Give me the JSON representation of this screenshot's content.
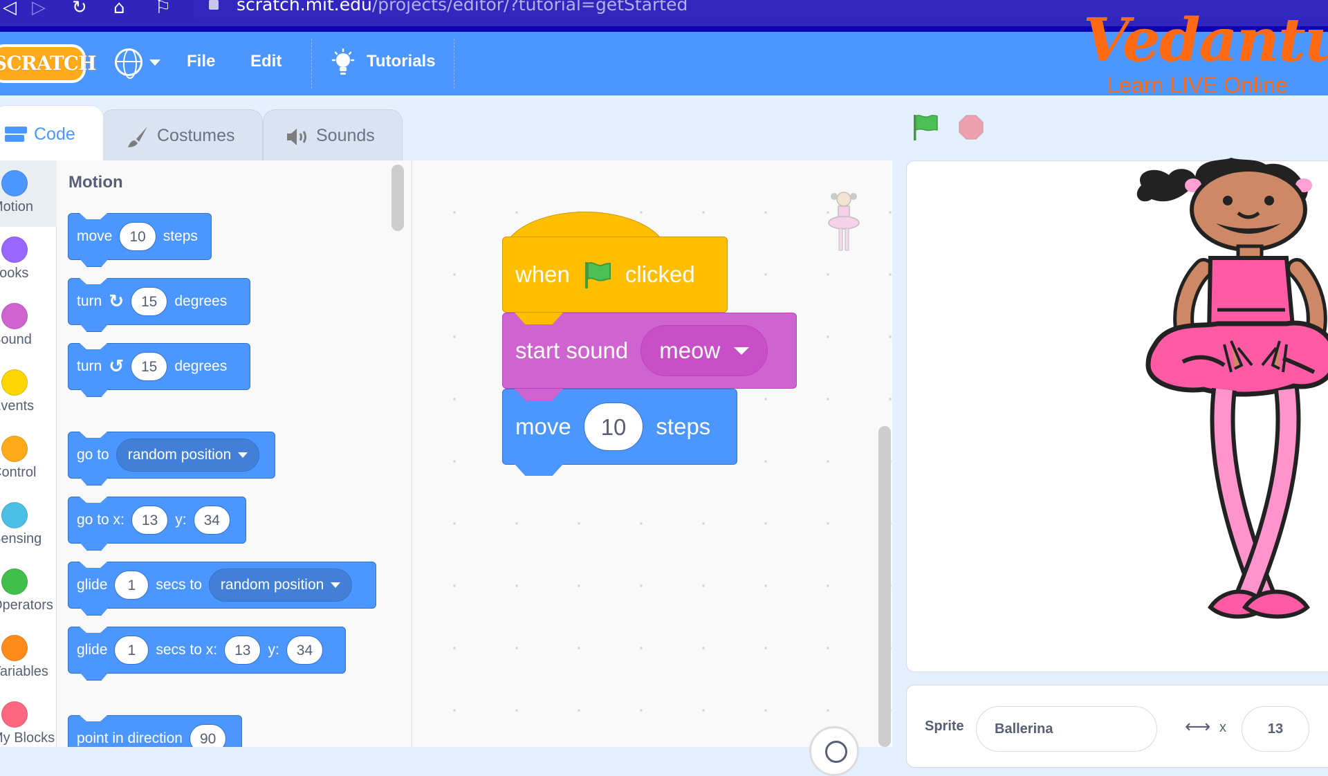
{
  "browser": {
    "url_host": "scratch.mit.edu",
    "url_path": "/projects/editor/?tutorial=getStarted"
  },
  "menu": {
    "logo": "SCRATCH",
    "file": "File",
    "edit": "Edit",
    "tutorials": "Tutorials"
  },
  "watermark": {
    "brand": "Vedantu",
    "tagline": "Learn LIVE Online",
    "color": "#ff6a13"
  },
  "tabs": [
    {
      "label": "Code",
      "active": true
    },
    {
      "label": "Costumes",
      "active": false
    },
    {
      "label": "Sounds",
      "active": false
    }
  ],
  "categories": [
    {
      "label": "Motion",
      "color": "#4c97ff",
      "selected": true
    },
    {
      "label": "Looks",
      "color": "#9966ff"
    },
    {
      "label": "Sound",
      "color": "#cf63cf"
    },
    {
      "label": "Events",
      "color": "#ffd500"
    },
    {
      "label": "Control",
      "color": "#ffab19"
    },
    {
      "label": "Sensing",
      "color": "#4cbfe6"
    },
    {
      "label": "Operators",
      "color": "#40bf4a"
    },
    {
      "label": "Variables",
      "color": "#ff8c1a"
    },
    {
      "label": "My Blocks",
      "color": "#ff6680"
    }
  ],
  "palette": {
    "title": "Motion",
    "blocks": {
      "move": {
        "pre": "move",
        "value": "10",
        "post": "steps"
      },
      "turn_right": {
        "pre": "turn",
        "value": "15",
        "post": "degrees"
      },
      "turn_left": {
        "pre": "turn",
        "value": "15",
        "post": "degrees"
      },
      "goto": {
        "pre": "go to",
        "menu": "random position"
      },
      "goto_xy": {
        "pre": "go to x:",
        "x": "13",
        "mid": "y:",
        "y": "34"
      },
      "glide": {
        "pre": "glide",
        "secs": "1",
        "mid": "secs to",
        "menu": "random position"
      },
      "glide_xy": {
        "pre": "glide",
        "secs": "1",
        "mid": "secs to x:",
        "x": "13",
        "mid2": "y:",
        "y": "34"
      },
      "point": {
        "pre": "point in direction",
        "value": "90"
      }
    }
  },
  "script": {
    "hat": {
      "pre": "when",
      "post": "clicked"
    },
    "sound": {
      "pre": "start sound",
      "menu": "meow"
    },
    "move": {
      "pre": "move",
      "value": "10",
      "post": "steps"
    }
  },
  "sprite_info": {
    "label": "Sprite",
    "name": "Ballerina",
    "x_label": "x",
    "x": "13"
  }
}
